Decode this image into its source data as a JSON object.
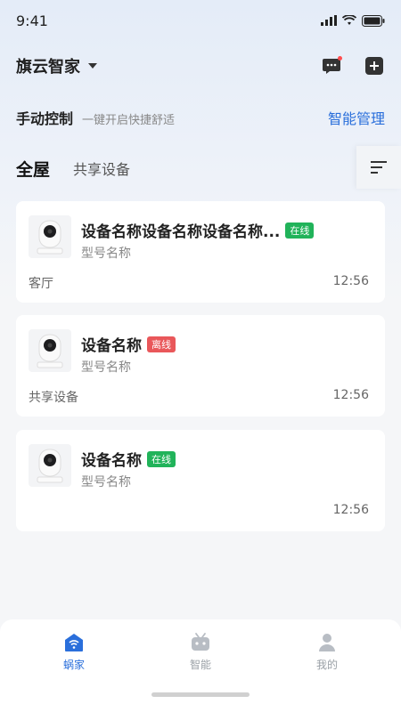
{
  "status_bar": {
    "time": "9:41"
  },
  "header": {
    "home_name": "旗云智家"
  },
  "quick_control": {
    "title": "手动控制",
    "subtitle": "一键开启快捷舒适",
    "manage_link": "智能管理"
  },
  "tabs": [
    {
      "label": "全屋",
      "active": true
    },
    {
      "label": "共享设备",
      "active": false
    }
  ],
  "devices": [
    {
      "name": "设备名称设备名称设备名称...",
      "status": "在线",
      "status_color": "#21b35a",
      "model": "型号名称",
      "room": "客厅",
      "time": "12:56"
    },
    {
      "name": "设备名称",
      "status": "离线",
      "status_color": "#e9575a",
      "model": "型号名称",
      "room": "共享设备",
      "time": "12:56"
    },
    {
      "name": "设备名称",
      "status": "在线",
      "status_color": "#21b35a",
      "model": "型号名称",
      "room": "",
      "time": "12:56"
    }
  ],
  "bottom_nav": [
    {
      "label": "蜗家",
      "icon": "home-wifi-icon",
      "active": true
    },
    {
      "label": "智能",
      "icon": "robot-icon",
      "active": false
    },
    {
      "label": "我的",
      "icon": "person-icon",
      "active": false
    }
  ],
  "colors": {
    "accent": "#2a6fdb",
    "online": "#21b35a",
    "offline": "#e9575a"
  }
}
